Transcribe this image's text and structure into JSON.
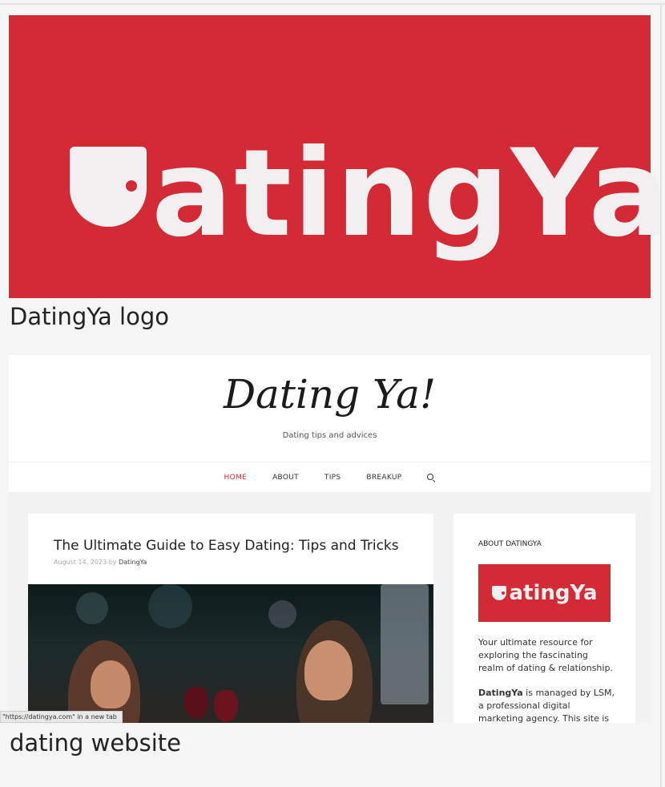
{
  "logo": {
    "wordmark": "atingYa",
    "caption": "DatingYa logo"
  },
  "website": {
    "site_title": "Dating Ya!",
    "tagline": "Dating tips and advices",
    "nav": [
      {
        "label": "HOME",
        "active": true
      },
      {
        "label": "ABOUT",
        "active": false
      },
      {
        "label": "TIPS",
        "active": false
      },
      {
        "label": "BREAKUP",
        "active": false
      }
    ],
    "search_icon": "search-icon",
    "article": {
      "title": "The Ultimate Guide to Easy Dating: Tips and Tricks",
      "date_by": "August 14, 2023 by",
      "author": "DatingYa"
    },
    "sidebar": {
      "heading": "ABOUT DATINGYA",
      "logo_text": "atingYa",
      "intro": "Your ultimate resource for exploring the fascinating realm of dating & relationship.",
      "brand": "DatingYa",
      "managed_text": "is managed by LSM, a professional digital marketing agency. This site is also a"
    },
    "caption": "dating website"
  },
  "tooltip": "\"https://datingya.com\" in a new tab",
  "colors": {
    "brand_red": "#d32a35",
    "nav_active": "#d32a35"
  }
}
